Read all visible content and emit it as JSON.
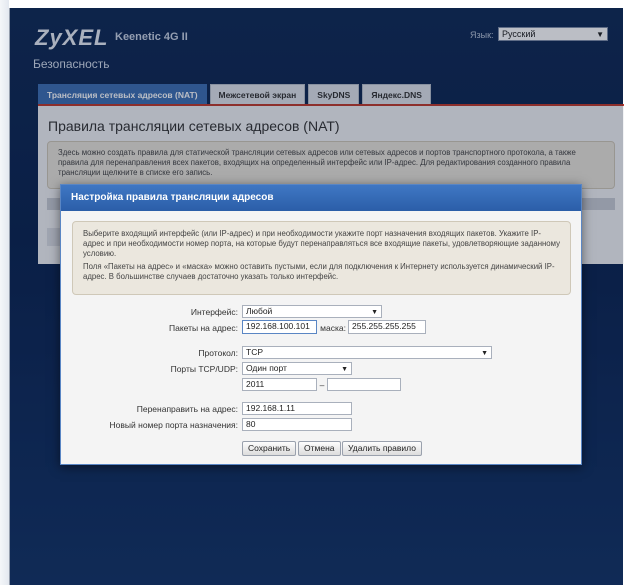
{
  "header": {
    "logo": "ZyXEL",
    "model": "Keenetic 4G II",
    "language_label": "Язык:",
    "language_value": "Русский",
    "section_title": "Безопасность"
  },
  "tabs": [
    {
      "label": "Трансляция сетевых адресов (NAT)",
      "active": true
    },
    {
      "label": "Межсетевой экран",
      "active": false
    },
    {
      "label": "SkyDNS",
      "active": false
    },
    {
      "label": "Яндекс.DNS",
      "active": false
    }
  ],
  "panel": {
    "title": "Правила трансляции сетевых адресов (NAT)",
    "info": "Здесь можно создать правила для статической трансляции сетевых адресов или сетевых адресов и портов транспортного протокола, а также правила для перенаправления всех пакетов, входящих на определенный интерфейс или IP-адрес. Для редактирования созданного правила трансляции щелкните в списке его запись."
  },
  "modal": {
    "title": "Настройка правила трансляции адресов",
    "info_p1": "Выберите входящий интерфейс (или IP-адрес) и при необходимости укажите порт назначения входящих пакетов. Укажите IP-адрес и при необходимости номер порта, на которые будут перенаправляться все входящие пакеты, удовлетворяющие заданному условию.",
    "info_p2": "Поля «Пакеты на адрес» и «маска» можно оставить пустыми, если для подключения к Интернету используется динамический IP-адрес. В большинстве случаев достаточно указать только интерфейс.",
    "interface_label": "Интерфейс:",
    "interface_value": "Любой",
    "packets_label": "Пакеты на адрес:",
    "packets_value": "192.168.100.101",
    "mask_label": "маска:",
    "mask_value": "255.255.255.255",
    "protocol_label": "Протокол:",
    "protocol_value": "TCP",
    "ports_label": "Порты TCP/UDP:",
    "ports_mode_value": "Один порт",
    "port_from_value": "2011",
    "port_dash": "–",
    "port_to_value": "",
    "redirect_label": "Перенаправить на адрес:",
    "redirect_value": "192.168.1.11",
    "new_port_label": "Новый номер порта назначения:",
    "new_port_value": "80",
    "save_button": "Сохранить",
    "cancel_button": "Отмена",
    "delete_button": "Удалить правило"
  },
  "icons": {
    "dropdown_arrow": "▼"
  },
  "colors": {
    "accent_blue": "#3d6fb3",
    "accent_red": "#c0392b",
    "background_navy": "#0f2a55"
  }
}
